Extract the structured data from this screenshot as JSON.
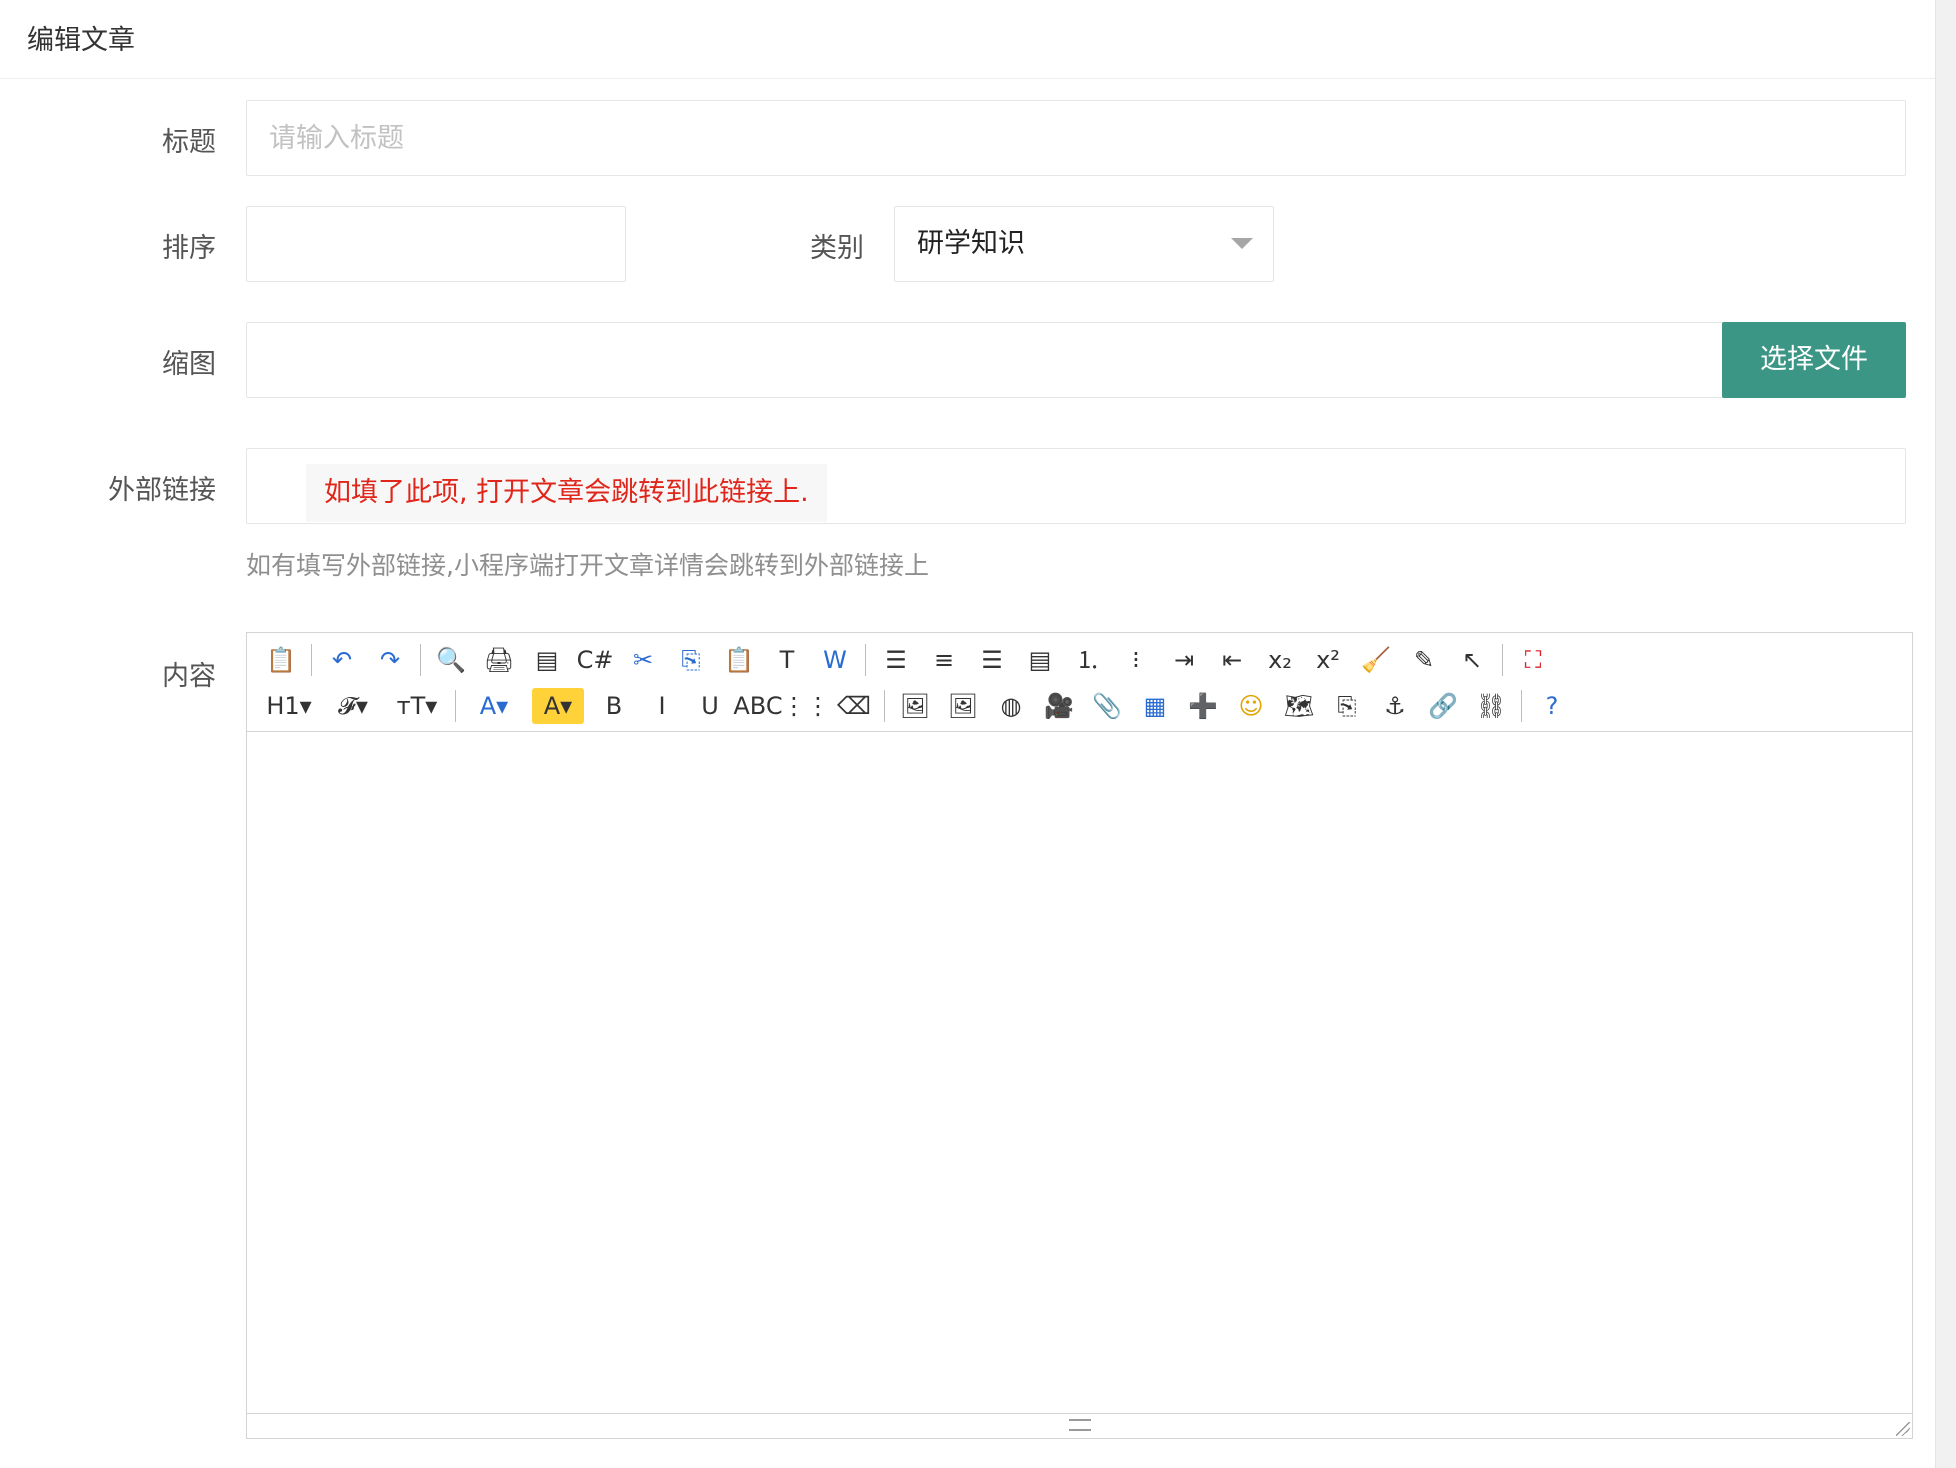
{
  "header": {
    "title": "编辑文章"
  },
  "form": {
    "title_label": "标题",
    "title_placeholder": "请输入标题",
    "title_value": "",
    "sort_label": "排序",
    "sort_value": "",
    "category_label": "类别",
    "category_value": "研学知识",
    "thumb_label": "缩图",
    "thumb_value": "",
    "choose_file_label": "选择文件",
    "external_link_label": "外部链接",
    "external_link_note": "如填了此项, 打开文章会跳转到此链接上.",
    "external_link_help": "如有填写外部链接,小程序端打开文章详情会跳转到外部链接上",
    "content_label": "内容"
  },
  "toolbar": {
    "row1": [
      {
        "name": "source-icon",
        "glyph": "📋"
      },
      {
        "sep": true
      },
      {
        "name": "undo-icon",
        "glyph": "↶",
        "color": "#2a6bd1"
      },
      {
        "name": "redo-icon",
        "glyph": "↷",
        "color": "#2a6bd1"
      },
      {
        "sep": true
      },
      {
        "name": "preview-icon",
        "glyph": "🔍"
      },
      {
        "name": "print-icon",
        "glyph": "🖨"
      },
      {
        "name": "template-icon",
        "glyph": "▤"
      },
      {
        "name": "code-icon",
        "glyph": "C#"
      },
      {
        "name": "cut-icon",
        "glyph": "✂",
        "color": "#2a6bd1"
      },
      {
        "name": "copy-icon",
        "glyph": "⎘",
        "color": "#2a6bd1"
      },
      {
        "name": "paste-icon",
        "glyph": "📋"
      },
      {
        "name": "paste-text-icon",
        "glyph": "T"
      },
      {
        "name": "paste-word-icon",
        "glyph": "W",
        "color": "#2a6bd1"
      },
      {
        "sep": true
      },
      {
        "name": "align-left-icon",
        "glyph": "☰"
      },
      {
        "name": "align-center-icon",
        "glyph": "≡"
      },
      {
        "name": "align-right-icon",
        "glyph": "☰"
      },
      {
        "name": "align-justify-icon",
        "glyph": "▤"
      },
      {
        "name": "ordered-list-icon",
        "glyph": "⒈"
      },
      {
        "name": "unordered-list-icon",
        "glyph": "⁝"
      },
      {
        "name": "indent-icon",
        "glyph": "⇥"
      },
      {
        "name": "outdent-icon",
        "glyph": "⇤"
      },
      {
        "name": "subscript-icon",
        "glyph": "x₂"
      },
      {
        "name": "superscript-icon",
        "glyph": "x²"
      },
      {
        "name": "clear-format-icon",
        "glyph": "🧹"
      },
      {
        "name": "quick-format-icon",
        "glyph": "✎"
      },
      {
        "name": "select-all-icon",
        "glyph": "↖"
      },
      {
        "sep": true
      },
      {
        "name": "fullscreen-icon",
        "glyph": "⛶",
        "color": "#d9262c"
      }
    ],
    "row2": [
      {
        "name": "heading-icon",
        "glyph": "H1▾",
        "wide": true
      },
      {
        "name": "font-family-icon",
        "glyph": "𝓕▾",
        "wide": true
      },
      {
        "name": "font-size-icon",
        "glyph": "ᴛT▾",
        "wide": true
      },
      {
        "sep": true
      },
      {
        "name": "font-color-icon",
        "glyph": "A▾",
        "color": "#2a6bd1",
        "wide": true
      },
      {
        "name": "highlight-color-icon",
        "glyph": "A▾",
        "bg": "#ffd23a",
        "wide": true
      },
      {
        "name": "bold-icon",
        "glyph": "B"
      },
      {
        "name": "italic-icon",
        "glyph": "I"
      },
      {
        "name": "underline-icon",
        "glyph": "U"
      },
      {
        "name": "strikethrough-icon",
        "glyph": "ABC"
      },
      {
        "name": "line-height-icon",
        "glyph": "⋮⋮"
      },
      {
        "name": "eraser-icon",
        "glyph": "⌫"
      },
      {
        "sep": true
      },
      {
        "name": "image-icon",
        "glyph": "🖼"
      },
      {
        "name": "multi-image-icon",
        "glyph": "🖼"
      },
      {
        "name": "flash-icon",
        "glyph": "◍"
      },
      {
        "name": "media-icon",
        "glyph": "🎥"
      },
      {
        "name": "attachment-icon",
        "glyph": "📎"
      },
      {
        "name": "table-icon",
        "glyph": "▦",
        "color": "#2a6bd1"
      },
      {
        "name": "hr-icon",
        "glyph": "➕",
        "color": "#2f9e2f"
      },
      {
        "name": "emoticon-icon",
        "glyph": "☺",
        "color": "#e2a400"
      },
      {
        "name": "map-icon",
        "glyph": "🗺"
      },
      {
        "name": "page-break-icon",
        "glyph": "⎘"
      },
      {
        "name": "anchor-icon",
        "glyph": "⚓"
      },
      {
        "name": "link-icon",
        "glyph": "🔗"
      },
      {
        "name": "unlink-icon",
        "glyph": "⛓"
      },
      {
        "sep": true
      },
      {
        "name": "help-icon",
        "glyph": "?",
        "color": "#2a6bd1"
      }
    ]
  }
}
